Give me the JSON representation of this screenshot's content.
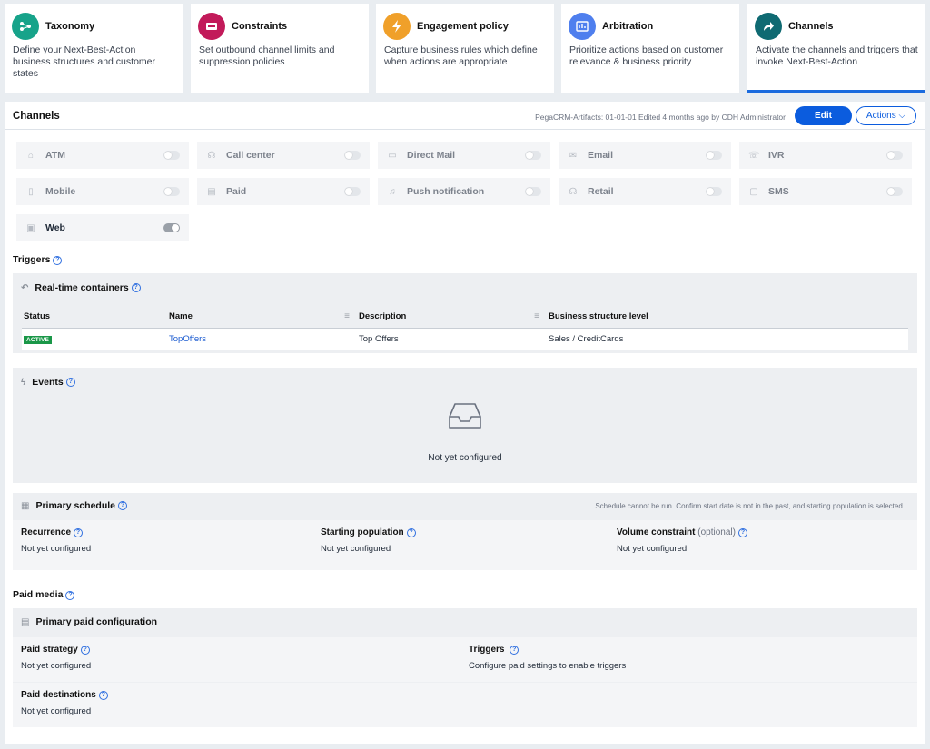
{
  "cards": [
    {
      "title": "Taxonomy",
      "desc": "Define your Next-Best-Action business structures and customer states",
      "color": "#17a38a",
      "icon": "taxonomy-icon",
      "glyph": "⋯"
    },
    {
      "title": "Constraints",
      "desc": "Set outbound channel limits and suppression policies",
      "color": "#c21a5a",
      "icon": "constraints-icon",
      "glyph": "▬"
    },
    {
      "title": "Engagement policy",
      "desc": "Capture business rules which define when actions are appropriate",
      "color": "#f0a02a",
      "icon": "lightning-icon",
      "glyph": "⚡"
    },
    {
      "title": "Arbitration",
      "desc": "Prioritize actions based on customer relevance & business priority",
      "color": "#4f7fee",
      "icon": "arbitration-icon",
      "glyph": "▦"
    },
    {
      "title": "Channels",
      "desc": "Activate the channels and triggers that invoke Next-Best-Action",
      "color": "#0f6a72",
      "icon": "share-arrow-icon",
      "glyph": "➦"
    }
  ],
  "header": {
    "title": "Channels",
    "meta": "PegaCRM-Artifacts: 01-01-01   Edited 4 months ago by CDH Administrator",
    "edit_label": "Edit",
    "actions_label": "Actions ⌵"
  },
  "channels": [
    {
      "label": "ATM",
      "icon": "bank-icon",
      "glyph": "⌂",
      "on": false
    },
    {
      "label": "Call center",
      "icon": "headset-icon",
      "glyph": "☊",
      "on": false
    },
    {
      "label": "Direct Mail",
      "icon": "mail-image-icon",
      "glyph": "▭",
      "on": false
    },
    {
      "label": "Email",
      "icon": "envelope-icon",
      "glyph": "✉",
      "on": false
    },
    {
      "label": "IVR",
      "icon": "phone-icon",
      "glyph": "☏",
      "on": false
    },
    {
      "label": "Mobile",
      "icon": "mobile-icon",
      "glyph": "▯",
      "on": false
    },
    {
      "label": "Paid",
      "icon": "paid-icon",
      "glyph": "▤",
      "on": false
    },
    {
      "label": "Push notification",
      "icon": "bell-icon",
      "glyph": "♫",
      "on": false
    },
    {
      "label": "Retail",
      "icon": "store-icon",
      "glyph": "☊",
      "on": false
    },
    {
      "label": "SMS",
      "icon": "chat-icon",
      "glyph": "▢",
      "on": false
    },
    {
      "label": "Web",
      "icon": "web-icon",
      "glyph": "▣",
      "on": true
    }
  ],
  "triggers": {
    "label": "Triggers",
    "realtime_title": "Real-time containers",
    "columns": [
      "Status",
      "Name",
      "Description",
      "Business structure level"
    ],
    "rows": [
      {
        "status": "ACTIVE",
        "name": "TopOffers",
        "description": "Top Offers",
        "level": "Sales / CreditCards"
      }
    ],
    "events_title": "Events",
    "events_empty": "Not yet configured"
  },
  "schedule": {
    "title": "Primary schedule",
    "note": "Schedule cannot be run. Confirm start date is not in the past, and starting population is selected.",
    "recurrence_label": "Recurrence",
    "recurrence_value": "Not yet configured",
    "population_label": "Starting population",
    "population_value": "Not yet configured",
    "volume_label": "Volume constraint",
    "volume_optional": "(optional)",
    "volume_value": "Not yet configured"
  },
  "paid_media": {
    "label": "Paid media",
    "config_title": "Primary paid configuration",
    "strategy_label": "Paid strategy",
    "strategy_value": "Not yet configured",
    "triggers_label": "Triggers",
    "triggers_value": "Configure paid settings to enable triggers",
    "destinations_label": "Paid destinations",
    "destinations_value": "Not yet configured"
  }
}
